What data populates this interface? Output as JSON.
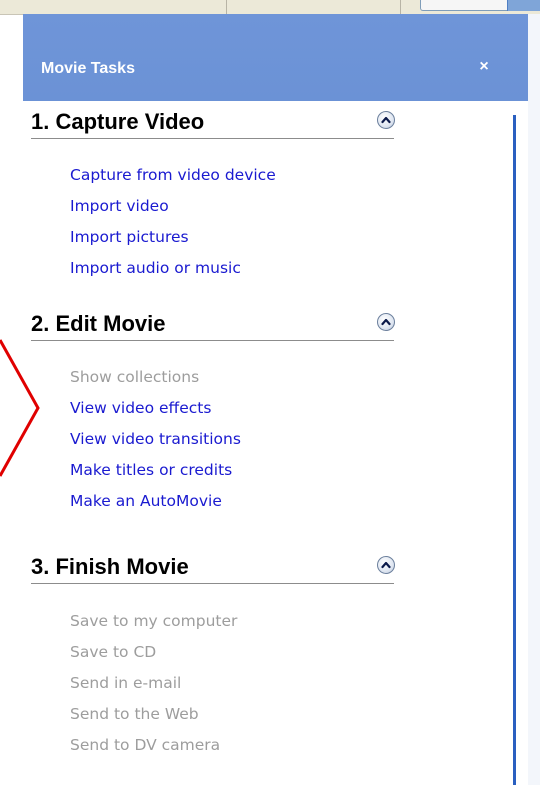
{
  "pane": {
    "title": "Movie Tasks",
    "close_glyph": "×"
  },
  "sections": [
    {
      "title": "1. Capture Video",
      "collapse_icon": "chevron-up-icon",
      "items": [
        {
          "label": "Capture from video device",
          "enabled": true
        },
        {
          "label": "Import video",
          "enabled": true
        },
        {
          "label": "Import pictures",
          "enabled": true
        },
        {
          "label": "Import audio or music",
          "enabled": true
        }
      ]
    },
    {
      "title": "2. Edit Movie",
      "collapse_icon": "chevron-up-icon",
      "items": [
        {
          "label": "Show collections",
          "enabled": false
        },
        {
          "label": "View video effects",
          "enabled": true
        },
        {
          "label": "View video transitions",
          "enabled": true
        },
        {
          "label": "Make titles or credits",
          "enabled": true
        },
        {
          "label": "Make an AutoMovie",
          "enabled": true
        }
      ]
    },
    {
      "title": "3. Finish Movie",
      "collapse_icon": "chevron-up-icon",
      "items": [
        {
          "label": "Save to my computer",
          "enabled": false
        },
        {
          "label": "Save to CD",
          "enabled": false
        },
        {
          "label": "Send in e-mail",
          "enabled": false
        },
        {
          "label": "Send to the Web",
          "enabled": false
        },
        {
          "label": "Send to DV camera",
          "enabled": false
        }
      ]
    }
  ],
  "colors": {
    "header_bg": "#6b92d6",
    "link_enabled": "#1a1ad0",
    "link_disabled": "#9d9d9d",
    "callout_arrow": "#e00000"
  }
}
